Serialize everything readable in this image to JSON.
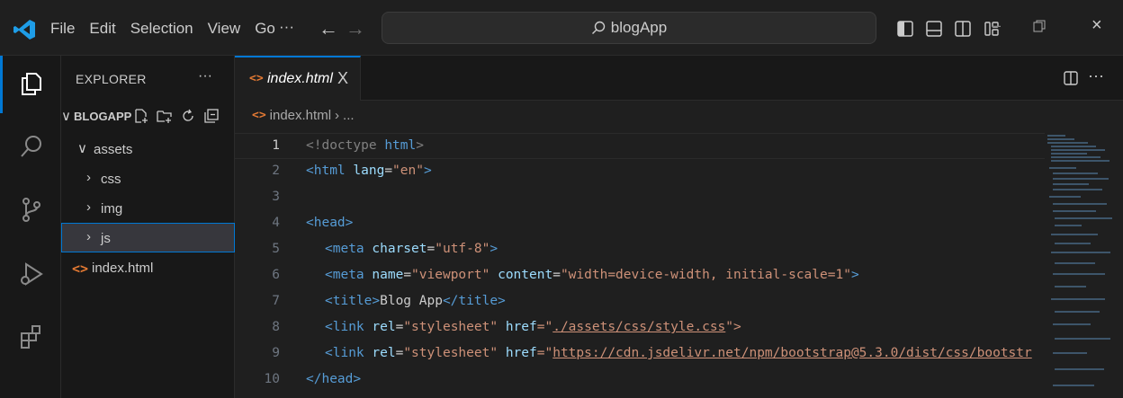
{
  "menu": [
    "File",
    "Edit",
    "Selection",
    "View",
    "Go"
  ],
  "more_glyph": "···",
  "search_text": "blogApp",
  "sidebar": {
    "title": "EXPLORER",
    "more_glyph": "···",
    "root_folder": "BLOGAPP",
    "tree": [
      {
        "label": "assets",
        "expanded": true
      },
      {
        "label": "css",
        "expanded": false
      },
      {
        "label": "img",
        "expanded": false
      },
      {
        "label": "js",
        "expanded": false,
        "selected": true
      },
      {
        "label": "index.html"
      }
    ]
  },
  "tab": {
    "label": "index.html",
    "close": "X"
  },
  "breadcrumb": {
    "file": "index.html",
    "rest": "..."
  },
  "code_lines": [
    {
      "n": "1"
    },
    {
      "n": "2"
    },
    {
      "n": "3"
    },
    {
      "n": "4"
    },
    {
      "n": "5"
    },
    {
      "n": "6"
    },
    {
      "n": "7"
    },
    {
      "n": "8"
    },
    {
      "n": "9"
    },
    {
      "n": "10"
    }
  ],
  "code": {
    "l1": [
      "<!doctype ",
      "html",
      ">"
    ],
    "l2": [
      "<html ",
      "lang",
      "=",
      "\"en\"",
      ">"
    ],
    "l4": [
      "<head>"
    ],
    "l5": [
      "<meta ",
      "charset",
      "=",
      "\"utf-8\"",
      ">"
    ],
    "l6": [
      "<meta ",
      "name",
      "=",
      "\"viewport\"",
      " content",
      "=",
      "\"width=device-width, initial-scale=1\"",
      ">"
    ],
    "l7": [
      "<title>",
      "Blog App",
      "</title>"
    ],
    "l8": [
      "<link ",
      "rel",
      "=",
      "\"stylesheet\"",
      " href",
      "=\"",
      "./assets/css/style.css",
      "\">"
    ],
    "l9": [
      "<link ",
      "rel",
      "=",
      "\"stylesheet\"",
      " href",
      "=\"",
      "https://cdn.jsdelivr.net/npm/bootstrap@5.3.0/dist/css/bootstr"
    ],
    "l10": [
      "</head>"
    ]
  },
  "colors": {
    "accent": "#0078d4",
    "tag": "#569cd6",
    "attr": "#9cdcfe",
    "string": "#ce9178",
    "html_icon": "#e37933"
  }
}
